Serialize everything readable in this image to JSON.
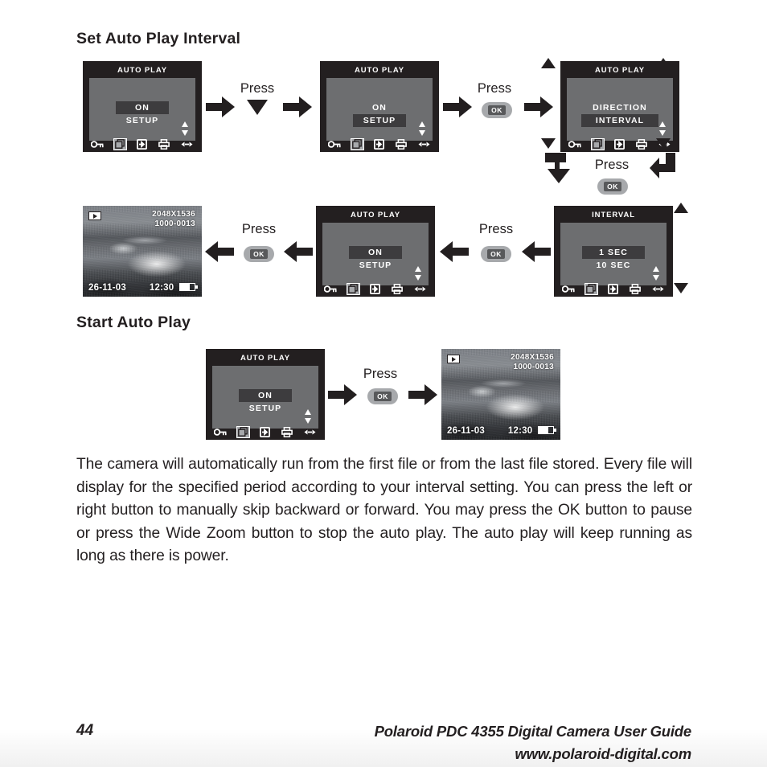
{
  "page": {
    "headings": {
      "set_interval": "Set Auto Play Interval",
      "start_auto_play": "Start Auto Play"
    },
    "body_text": "The camera will automatically run from the first file or from the last file stored. Every file will display for the specified period according to your interval setting. You can press the left or right button to manually skip backward or forward. You may press the OK button to pause or press the Wide Zoom button to stop the auto play. The auto play will keep running as long as there is power.",
    "footer": {
      "page_number": "44",
      "guide_title": "Polaroid PDC 4355 Digital Camera User Guide",
      "website": "www.polaroid-digital.com"
    }
  },
  "labels": {
    "press": "Press",
    "ok": "OK"
  },
  "screens": {
    "autoplay_on": {
      "title": "AUTO PLAY",
      "items": [
        {
          "label": "ON",
          "selected": true
        },
        {
          "label": "SETUP",
          "selected": false
        }
      ]
    },
    "autoplay_setup": {
      "title": "AUTO PLAY",
      "items": [
        {
          "label": "ON",
          "selected": false
        },
        {
          "label": "SETUP",
          "selected": true
        }
      ]
    },
    "autoplay_direction": {
      "title": "AUTO PLAY",
      "items": [
        {
          "label": "DIRECTION",
          "selected": false
        },
        {
          "label": "INTERVAL",
          "selected": true
        }
      ]
    },
    "interval": {
      "title": "INTERVAL",
      "items": [
        {
          "label": "1 SEC",
          "selected": true
        },
        {
          "label": "10 SEC",
          "selected": false
        }
      ]
    }
  },
  "icon_bar": [
    {
      "name": "key-icon",
      "highlighted": false
    },
    {
      "name": "multi-image-icon",
      "highlighted": true
    },
    {
      "name": "transfer-icon",
      "highlighted": false
    },
    {
      "name": "print-icon",
      "highlighted": false
    },
    {
      "name": "left-right-arrows-icon",
      "highlighted": false
    }
  ],
  "photo_preview": {
    "mode_icon": "play-mode-icon",
    "resolution": "2048X1536",
    "file_number": "1000-0013",
    "date": "26-11-03",
    "time": "12:30",
    "battery_icon": "battery-icon"
  },
  "colors": {
    "ink": "#231f20",
    "lcd_body": "#6d6e70",
    "lcd_selected": "#3d3c3e",
    "ok_pill": "#a7a9ac",
    "ok_chip": "#58595b"
  }
}
